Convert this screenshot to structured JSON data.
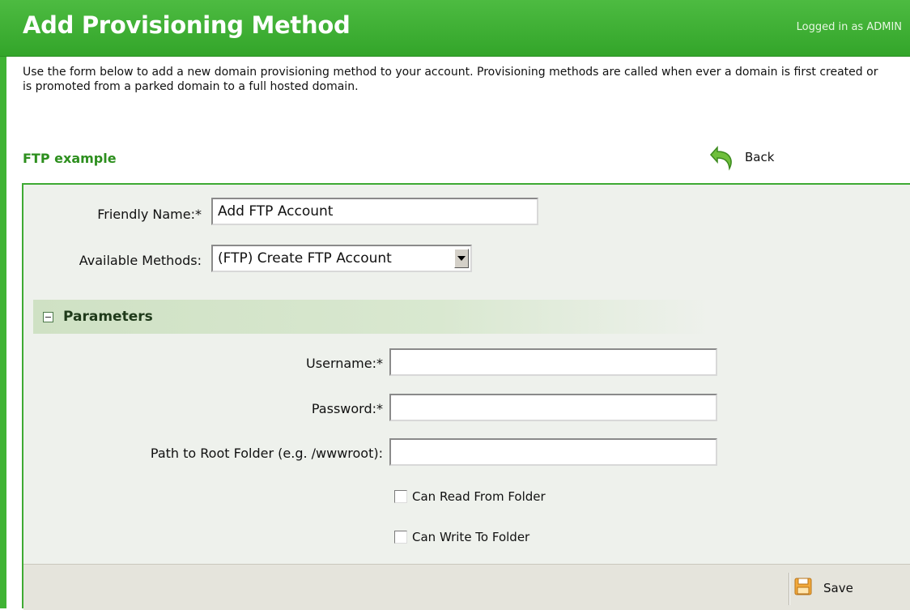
{
  "header": {
    "title": "Add Provisioning Method",
    "login_status": "Logged in as ADMIN"
  },
  "intro_text": "Use the form below to add a new domain provisioning method to your account. Provisioning methods are called when ever a domain is first created or is promoted from a parked domain to a full hosted domain.",
  "section": {
    "title": "FTP example",
    "back_label": "Back",
    "back_icon": "back-arrow-icon"
  },
  "form": {
    "friendly_name_label": "Friendly Name:*",
    "friendly_name_value": "Add FTP Account",
    "available_methods_label": "Available Methods:",
    "available_methods_selected": "(FTP) Create FTP Account",
    "parameters_header": "Parameters",
    "username_label": "Username:*",
    "username_value": "",
    "password_label": "Password:*",
    "password_value": "",
    "path_label": "Path to Root Folder (e.g. /wwwroot):",
    "path_value": "",
    "can_read_label": "Can Read From Folder",
    "can_read_checked": false,
    "can_write_label": "Can Write To Folder",
    "can_write_checked": false
  },
  "footer": {
    "save_label": "Save",
    "save_icon": "save-floppy-icon"
  },
  "colors": {
    "header_green": "#3fb334",
    "section_title": "#2d8f1e",
    "panel_bg": "#eef1ec"
  }
}
